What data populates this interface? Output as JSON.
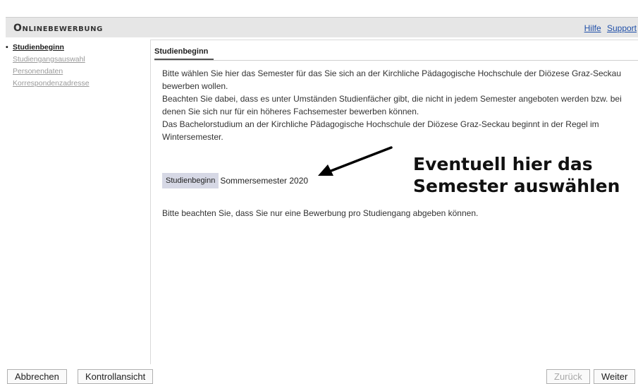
{
  "header": {
    "title": "Onlinebewerbung",
    "links": [
      "Hilfe",
      "Support"
    ]
  },
  "sidebar": {
    "items": [
      {
        "label": "Studienbeginn"
      },
      {
        "label": "Studiengangsauswahl"
      },
      {
        "label": "Personendaten"
      },
      {
        "label": "Korrespondenzadresse"
      }
    ]
  },
  "main": {
    "tab": "Studienbeginn",
    "paragraphs": [
      "Bitte wählen Sie hier das Semester für das Sie sich an der Kirchliche Pädagogische Hochschule der Diözese Graz-Seckau bewerben wollen.",
      "Beachten Sie dabei, dass es unter Umständen Studienfächer gibt, die nicht in jedem Semester angeboten werden bzw. bei denen Sie sich nur für ein höheres Fachsemester bewerben können.",
      "Das Bachelorstudium an der Kirchliche Pädagogische Hochschule der Diözese Graz-Seckau beginnt in der Regel im Wintersemester."
    ],
    "field_label": "Studienbeginn",
    "field_value": "Sommersemester 2020",
    "note": "Bitte beachten Sie, dass Sie nur eine Bewerbung pro Studiengang abgeben können."
  },
  "annotation": {
    "line1": "Eventuell hier das",
    "line2": "Semester auswählen"
  },
  "footer": {
    "cancel": "Abbrechen",
    "review": "Kontrollansicht",
    "back": "Zurück",
    "next": "Weiter"
  }
}
